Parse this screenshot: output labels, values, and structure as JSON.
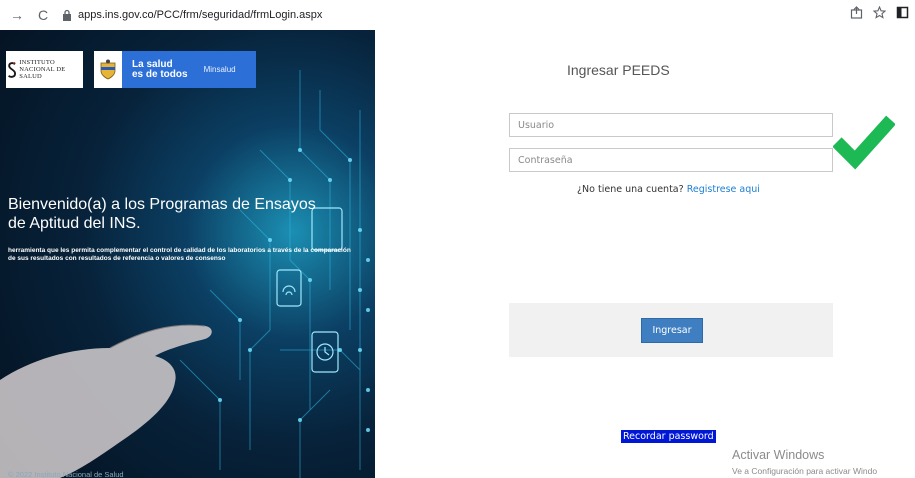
{
  "browser": {
    "url": "apps.ins.gov.co/PCC/frm/seguridad/frmLogin.aspx",
    "back_icon": "→",
    "reload_icon": "C"
  },
  "hero": {
    "ins_logo_text": "Instituto Nacional de Salud",
    "salud_line1": "La salud",
    "salud_line2": "es de todos",
    "minsalud": "Minsalud",
    "title": "Bienvenido(a) a los Programas de Ensayos de Aptitud del INS.",
    "description": "herramienta que les permita complementar el control de calidad de los laboratorios a través de la comparación de sus resultados con resultados de referencia o valores de consenso",
    "footer": "© 2022 Instituto Nacional de Salud"
  },
  "login": {
    "title": "Ingresar PEEDS",
    "username_placeholder": "Usuario",
    "password_placeholder": "Contraseña",
    "no_account_text": "¿No tiene una cuenta?",
    "register_link": "Registrese aqui",
    "submit_label": "Ingresar",
    "recover_label": "Recordar password"
  },
  "windows_watermark": {
    "title": "Activar Windows",
    "subtitle": "Ve a Configuración para activar Windo"
  },
  "colors": {
    "accent_button": "#3f7fc1",
    "recover_bg": "#0017d6",
    "check": "#1db954",
    "link": "#1e7fd4"
  }
}
